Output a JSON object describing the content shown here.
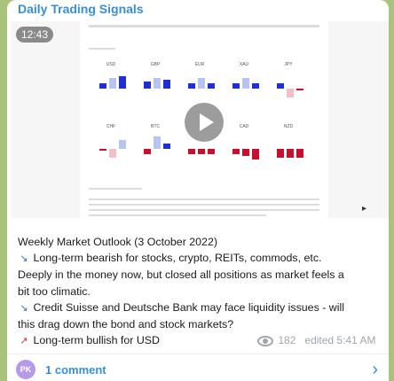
{
  "channel": {
    "name": "Daily Trading Signals"
  },
  "video": {
    "duration": "12:43",
    "play_icon": "play-icon"
  },
  "doc_preview": {
    "row1": [
      "USD",
      "GBP",
      "EUR",
      "XAU",
      "JPY"
    ],
    "row2": [
      "CHF",
      "BTC",
      "CAD",
      "NZD"
    ]
  },
  "caption": {
    "line1": "Weekly Market Outlook (3 October 2022)",
    "line2_icon": "chart-decreasing-icon",
    "line2": "Long-term bearish for stocks, crypto, REITs, commods, etc.",
    "line3": "Deeply in the money now, but closed all positions as market feels a",
    "line4": "bit too climatic.",
    "line5_icon": "chart-decreasing-icon",
    "line5": "Credit Suisse and Deutsche Bank may face liquidity issues - will",
    "line6": "this drag down the bond and stock markets?",
    "line7_icon": "chart-increasing-icon",
    "line7": "Long-term bullish for USD"
  },
  "meta": {
    "views": "182",
    "edited": "edited 5:41 AM"
  },
  "footer": {
    "avatar": "PK",
    "comments": "1 comment"
  },
  "colors": {
    "accent": "#3a8fd0",
    "bull": "#1f2fd1",
    "bear": "#c8102e"
  }
}
